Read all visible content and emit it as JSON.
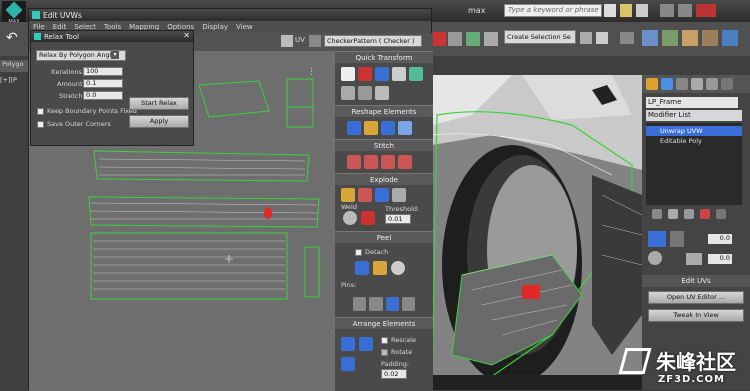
{
  "app": {
    "logo": "MAX",
    "max_title_fragment": "max",
    "search_placeholder": "Type a keyword or phrase"
  },
  "edit_uvws": {
    "title": "Edit UVWs",
    "menu": [
      "File",
      "Edit",
      "Select",
      "Tools",
      "Mapping",
      "Options",
      "Display",
      "View"
    ],
    "uv_label": "UV",
    "pattern": "CheckerPattern ( Checker )"
  },
  "relax": {
    "title": "Relax Tool",
    "method": "Relax By Polygon Angles",
    "iterations_label": "Iterations:",
    "iterations": "100",
    "amount_label": "Amount:",
    "amount": "0.1",
    "stretch_label": "Stretch:",
    "stretch": "0.0",
    "keep_boundary": "Keep Boundary Points Fixed",
    "save_corners": "Save Outer Corners",
    "start_relax": "Start Relax",
    "apply": "Apply"
  },
  "rollouts": {
    "quick_transform": "Quick Transform",
    "reshape": "Reshape Elements",
    "stitch": "Stitch",
    "explode": "Explode",
    "weld": "Weld",
    "threshold_label": "Threshold:",
    "threshold": "0.01",
    "peel": "Peel",
    "detach": "Detach",
    "pins": "Pins:",
    "arrange": "Arrange Elements",
    "rescale": "Rescale",
    "rotate": "Rotate",
    "padding_label": "Padding:",
    "padding": "0.02"
  },
  "toolbar": {
    "selection_set": "Create Selection Se"
  },
  "cmd_panel": {
    "object_name": "LP_Frame",
    "modifier_list": "Modifier List",
    "stack": [
      "Unwrap UVW",
      "Editable Poly"
    ],
    "spinner1": "0.0",
    "spinner2": "0.0",
    "edit_uvs": "Edit UVs",
    "open_uv_editor": "Open UV Editor ...",
    "tweak_in_view": "Tweak In View"
  },
  "viewport": {
    "label": "[+][P"
  },
  "side_tab": "Polygo",
  "watermark": {
    "cn": "朱峰社区",
    "url": "ZF3D.COM"
  },
  "colors": {
    "selection_blue": "#3a6fd8",
    "uv_green": "#3cd23c",
    "accent_red": "#e02a2a"
  }
}
